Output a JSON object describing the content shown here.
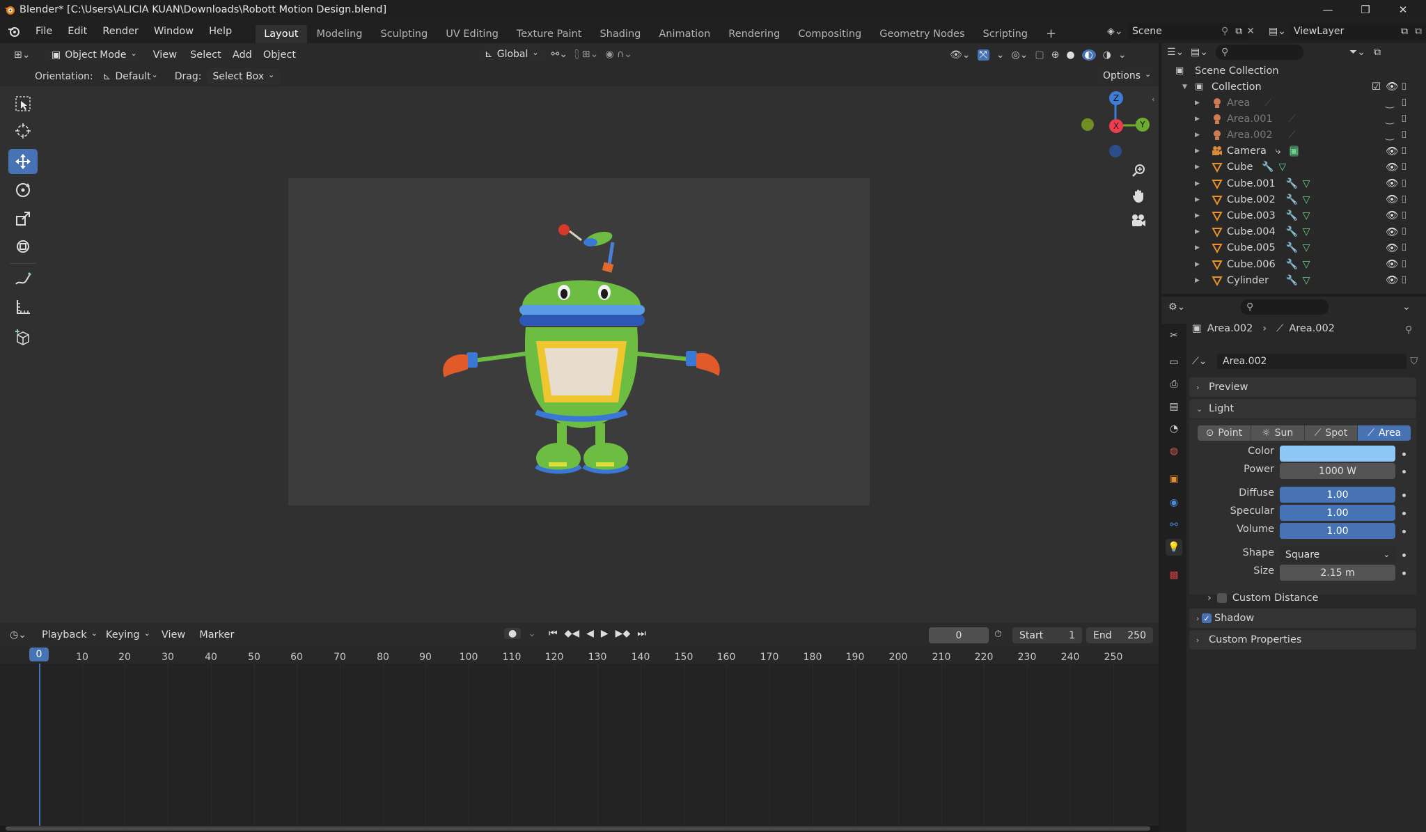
{
  "titlebar": {
    "title": "Blender* [C:\\Users\\ALICIA KUAN\\Downloads\\Robott Motion Design.blend]"
  },
  "menu": {
    "file": "File",
    "edit": "Edit",
    "render": "Render",
    "window": "Window",
    "help": "Help"
  },
  "workspaces": [
    "Layout",
    "Modeling",
    "Sculpting",
    "UV Editing",
    "Texture Paint",
    "Shading",
    "Animation",
    "Rendering",
    "Compositing",
    "Geometry Nodes",
    "Scripting"
  ],
  "scene": {
    "label": "Scene",
    "viewlayer": "ViewLayer"
  },
  "viewport": {
    "mode": "Object Mode",
    "menus": [
      "View",
      "Select",
      "Add",
      "Object"
    ],
    "transform": "Global",
    "orientation_label": "Orientation:",
    "orientation_value": "Default",
    "drag_label": "Drag:",
    "drag_value": "Select Box",
    "options": "Options",
    "gizmo": {
      "z": "Z",
      "x": "X",
      "y": "Y"
    }
  },
  "timeline": {
    "menus": [
      "Playback",
      "Keying",
      "View",
      "Marker"
    ],
    "current_frame": "0",
    "start_label": "Start",
    "start": "1",
    "end_label": "End",
    "end": "250",
    "ticks": [
      "0",
      "10",
      "20",
      "30",
      "40",
      "50",
      "60",
      "70",
      "80",
      "90",
      "100",
      "110",
      "120",
      "130",
      "140",
      "150",
      "160",
      "170",
      "180",
      "190",
      "200",
      "210",
      "220",
      "230",
      "240",
      "250"
    ]
  },
  "outliner": {
    "root": "Scene Collection",
    "collection": "Collection",
    "items": [
      {
        "name": "Area",
        "type": "light",
        "hidden": true
      },
      {
        "name": "Area.001",
        "type": "light",
        "hidden": true
      },
      {
        "name": "Area.002",
        "type": "light",
        "hidden": true
      },
      {
        "name": "Camera",
        "type": "camera",
        "hidden": false
      },
      {
        "name": "Cube",
        "type": "mesh",
        "hidden": false
      },
      {
        "name": "Cube.001",
        "type": "mesh",
        "hidden": false
      },
      {
        "name": "Cube.002",
        "type": "mesh",
        "hidden": false
      },
      {
        "name": "Cube.003",
        "type": "mesh",
        "hidden": false
      },
      {
        "name": "Cube.004",
        "type": "mesh",
        "hidden": false
      },
      {
        "name": "Cube.005",
        "type": "mesh",
        "hidden": false
      },
      {
        "name": "Cube.006",
        "type": "mesh",
        "hidden": false
      },
      {
        "name": "Cylinder",
        "type": "mesh",
        "hidden": false
      }
    ]
  },
  "properties": {
    "breadcrumb_object": "Area.002",
    "breadcrumb_data": "Area.002",
    "datablock": "Area.002",
    "preview": "Preview",
    "light": "Light",
    "light_types": [
      "Point",
      "Sun",
      "Spot",
      "Area"
    ],
    "active_type": "Area",
    "color_label": "Color",
    "color": "#8cc7f7",
    "power_label": "Power",
    "power": "1000 W",
    "diffuse_label": "Diffuse",
    "diffuse": "1.00",
    "specular_label": "Specular",
    "specular": "1.00",
    "volume_label": "Volume",
    "volume": "1.00",
    "shape_label": "Shape",
    "shape": "Square",
    "size_label": "Size",
    "size": "2.15 m",
    "custom_distance": "Custom Distance",
    "shadow": "Shadow",
    "custom_properties": "Custom Properties"
  }
}
